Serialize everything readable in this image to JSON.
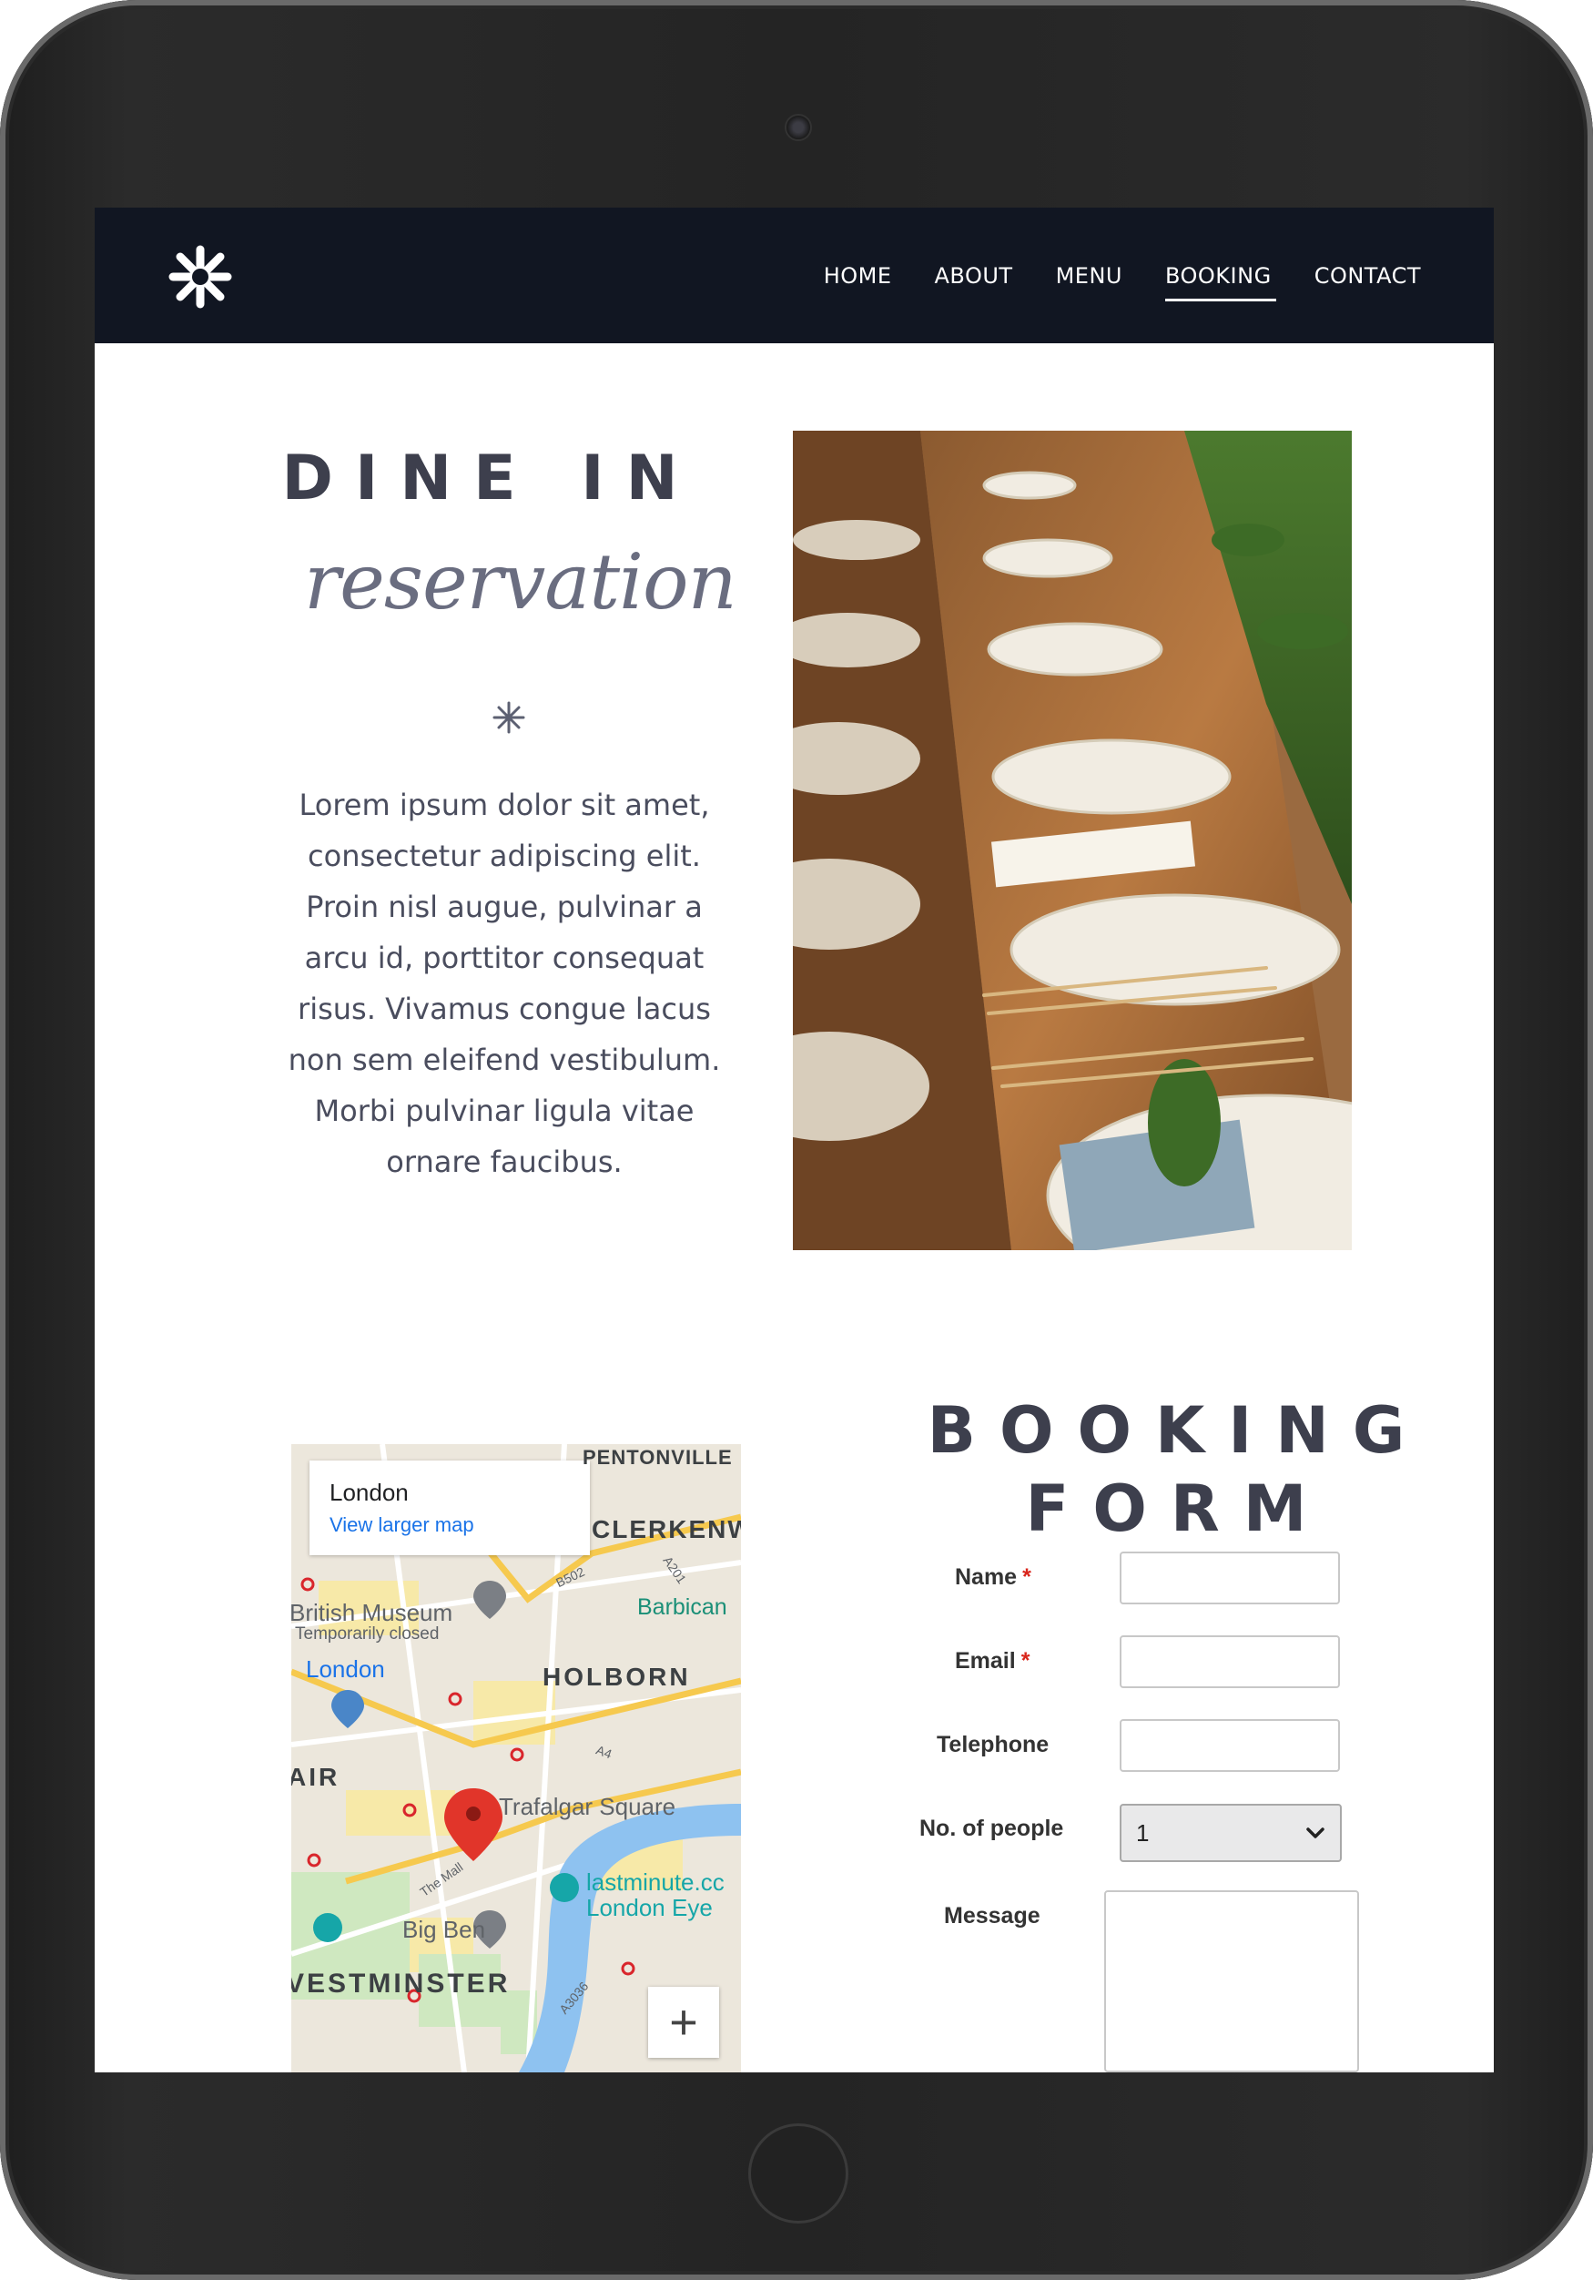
{
  "nav": {
    "items": [
      {
        "label": "HOME"
      },
      {
        "label": "ABOUT"
      },
      {
        "label": "MENU"
      },
      {
        "label": "BOOKING"
      },
      {
        "label": "CONTACT"
      }
    ],
    "active": "BOOKING"
  },
  "intro": {
    "title": "DINE IN",
    "subtitle": "reservation",
    "body": "Lorem ipsum dolor sit amet, consectetur adipiscing elit. Proin nisl augue, pulvinar a arcu id, porttitor consequat risus. Vivamus congue lacus non sem eleifend vestibulum. Morbi pulvinar ligula vitae ornare faucibus."
  },
  "map": {
    "city": "London",
    "larger_map_link": "View larger map",
    "labels": {
      "pentonville": "PENTONVILLE",
      "clerkenwell": "CLERKENW",
      "british_museum": "British Museum",
      "temporarily_closed": "Temporarily closed",
      "barbican": "Barbican",
      "london": "London",
      "holborn": "HOLBORN",
      "mayfair": "AIR",
      "trafalgar": "Trafalgar Square",
      "lastminute": "lastminute.cc",
      "london_eye": "London Eye",
      "big_ben": "Big Ben",
      "westminster": "VESTMINSTER",
      "the_mall": "The Mall",
      "b502": "B502",
      "a201": "A201",
      "a4": "A4",
      "a3036": "A3036"
    },
    "zoom_in": "+"
  },
  "booking": {
    "title_line1": "BOOKING",
    "title_line2": "FORM",
    "required_mark": "*",
    "name_label": "Name",
    "email_label": "Email",
    "telephone_label": "Telephone",
    "people_label": "No. of people",
    "people_value": "1",
    "message_label": "Message"
  },
  "colors": {
    "header_bg": "#111622",
    "heading": "#3d3f4d",
    "script": "#6a6d80",
    "required": "#d9261c",
    "map_link": "#1a73e8"
  }
}
